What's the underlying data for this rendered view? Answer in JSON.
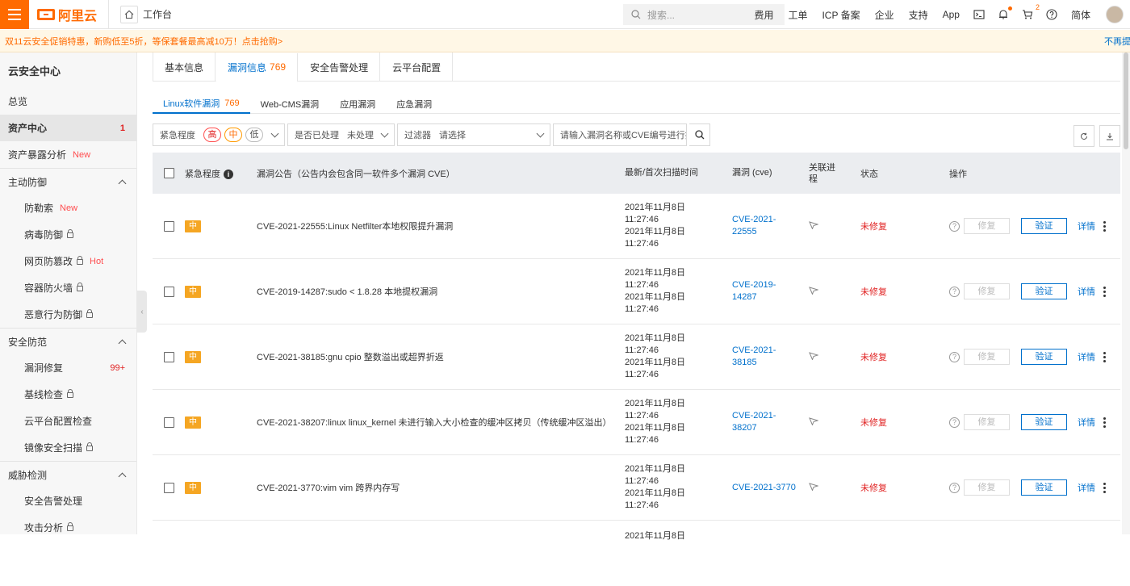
{
  "topbar": {
    "logo_text": "阿里云",
    "workbench": "工作台",
    "search_placeholder": "搜索...",
    "links": [
      "费用",
      "工单",
      "ICP 备案",
      "企业",
      "支持",
      "App"
    ],
    "cart_count": "2",
    "lang": "简体"
  },
  "promo": {
    "text": "双11云安全促销特惠，新购低至5折，等保套餐最高减10万！点击抢购>",
    "dismiss": "不再提示"
  },
  "sidebar": {
    "title": "云安全中心",
    "overview": "总览",
    "asset_center": "资产中心",
    "asset_center_badge": "1",
    "exposure": "资产暴露分析",
    "exposure_tag": "New",
    "groups": {
      "active_defense": "主动防御",
      "security_defense": "安全防范",
      "threat_detection": "威胁检测"
    },
    "items": {
      "ransomware": "防勒索",
      "ransomware_tag": "New",
      "antivirus": "病毒防御",
      "webtamper": "网页防篡改",
      "webtamper_tag": "Hot",
      "container_fw": "容器防火墙",
      "malicious": "恶意行为防御",
      "vuln_fix": "漏洞修复",
      "vuln_fix_badge": "99+",
      "baseline": "基线检查",
      "cloud_config": "云平台配置检查",
      "image_scan": "镜像安全扫描",
      "alert": "安全告警处理",
      "attack": "攻击分析"
    }
  },
  "main": {
    "tabs": [
      {
        "label": "基本信息",
        "count": ""
      },
      {
        "label": "漏洞信息",
        "count": "769"
      },
      {
        "label": "安全告警处理",
        "count": ""
      },
      {
        "label": "云平台配置",
        "count": ""
      }
    ],
    "subtabs": [
      {
        "label": "Linux软件漏洞",
        "count": "769"
      },
      {
        "label": "Web-CMS漏洞",
        "count": ""
      },
      {
        "label": "应用漏洞",
        "count": ""
      },
      {
        "label": "应急漏洞",
        "count": ""
      }
    ],
    "filters": {
      "urgency_label": "紧急程度",
      "urgency_high": "高",
      "urgency_mid": "中",
      "urgency_low": "低",
      "handled_label": "是否已处理",
      "handled_value": "未处理",
      "filter_label": "过滤器",
      "filter_value": "请选择",
      "search_placeholder": "请输入漏洞名称或CVE编号进行搜"
    },
    "columns": {
      "urgency": "紧急程度",
      "bulletin": "漏洞公告（公告内会包含同一软件多个漏洞 CVE）",
      "scan_time": "最新/首次扫描时间",
      "cve": "漏洞 (cve)",
      "process": "关联进程",
      "status": "状态",
      "actions": "操作"
    },
    "rows": [
      {
        "level": "中",
        "name": "CVE-2021-22555:Linux Netfilter本地权限提升漏洞",
        "t1": "2021年11月8日",
        "t2": "11:27:46",
        "t3": "2021年11月8日",
        "t4": "11:27:46",
        "cve1": "CVE-2021-",
        "cve2": "22555",
        "status": "未修复",
        "fix": "修复",
        "verify": "验证",
        "detail": "详情"
      },
      {
        "level": "中",
        "name": "CVE-2019-14287:sudo < 1.8.28 本地提权漏洞",
        "t1": "2021年11月8日",
        "t2": "11:27:46",
        "t3": "2021年11月8日",
        "t4": "11:27:46",
        "cve1": "CVE-2019-",
        "cve2": "14287",
        "status": "未修复",
        "fix": "修复",
        "verify": "验证",
        "detail": "详情"
      },
      {
        "level": "中",
        "name": "CVE-2021-38185:gnu cpio 整数溢出或超界折返",
        "t1": "2021年11月8日",
        "t2": "11:27:46",
        "t3": "2021年11月8日",
        "t4": "11:27:46",
        "cve1": "CVE-2021-",
        "cve2": "38185",
        "status": "未修复",
        "fix": "修复",
        "verify": "验证",
        "detail": "详情"
      },
      {
        "level": "中",
        "name": "CVE-2021-38207:linux linux_kernel 未进行输入大小检查的缓冲区拷贝（传统缓冲区溢出）",
        "t1": "2021年11月8日",
        "t2": "11:27:46",
        "t3": "2021年11月8日",
        "t4": "11:27:46",
        "cve1": "CVE-2021-",
        "cve2": "38207",
        "status": "未修复",
        "fix": "修复",
        "verify": "验证",
        "detail": "详情"
      },
      {
        "level": "中",
        "name": "CVE-2021-3770:vim vim 跨界内存写",
        "t1": "2021年11月8日",
        "t2": "11:27:46",
        "t3": "2021年11月8日",
        "t4": "11:27:46",
        "cve1": "CVE-2021-3770",
        "cve2": "",
        "status": "未修复",
        "fix": "修复",
        "verify": "验证",
        "detail": "详情"
      }
    ],
    "partial_row_time": "2021年11月8日"
  }
}
